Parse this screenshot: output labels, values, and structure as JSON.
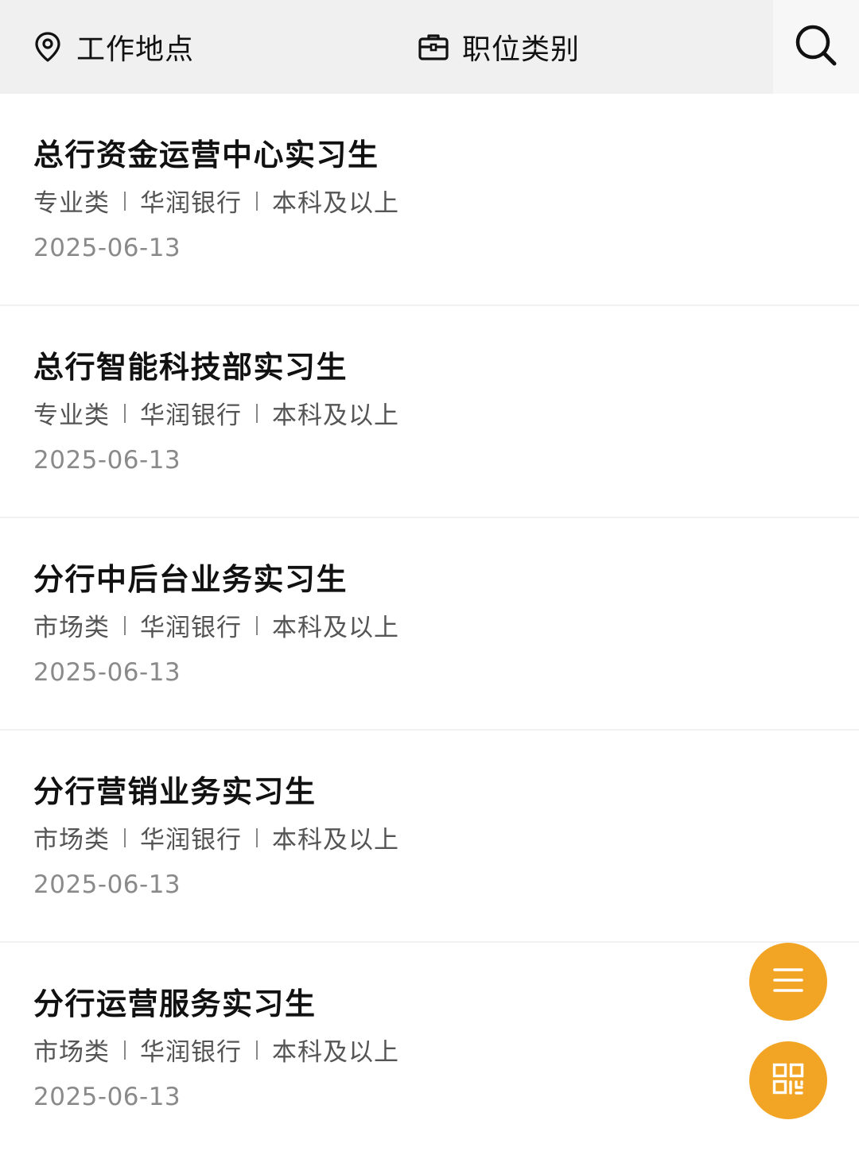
{
  "filters": {
    "location_label": "工作地点",
    "category_label": "职位类别",
    "location_icon": "location-pin-icon",
    "category_icon": "briefcase-icon",
    "search_icon": "search-icon"
  },
  "jobs": [
    {
      "title": "总行资金运营中心实习生",
      "category": "专业类",
      "company": "华润银行",
      "education": "本科及以上",
      "date": "2025-06-13"
    },
    {
      "title": "总行智能科技部实习生",
      "category": "专业类",
      "company": "华润银行",
      "education": "本科及以上",
      "date": "2025-06-13"
    },
    {
      "title": "分行中后台业务实习生",
      "category": "市场类",
      "company": "华润银行",
      "education": "本科及以上",
      "date": "2025-06-13"
    },
    {
      "title": "分行营销业务实习生",
      "category": "市场类",
      "company": "华润银行",
      "education": "本科及以上",
      "date": "2025-06-13"
    },
    {
      "title": "分行运营服务实习生",
      "category": "市场类",
      "company": "华润银行",
      "education": "本科及以上",
      "date": "2025-06-13"
    }
  ],
  "fabs": {
    "menu_icon": "menu-icon",
    "qr_icon": "qr-code-icon",
    "color": "#f2a524"
  },
  "colors": {
    "topbar_bg": "#f0f0f0",
    "title": "#111111",
    "meta": "#555555",
    "date": "#8a8a8a"
  }
}
